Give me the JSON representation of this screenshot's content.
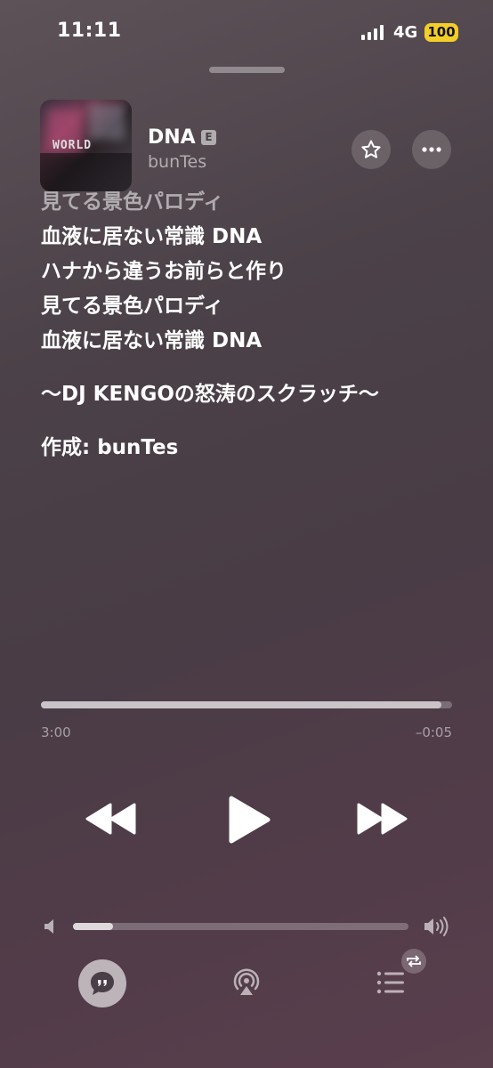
{
  "status": {
    "time": "11:11",
    "network": "4G",
    "battery": "100"
  },
  "track": {
    "title": "DNA",
    "explicit_badge": "E",
    "artist": "bunTes",
    "artwork_text": "WORLD"
  },
  "lyrics": {
    "lines": [
      "見てる景色パロディ",
      "血液に居ない常識 DNA",
      "ハナから違うお前らと作り",
      "見てる景色パロディ",
      "血液に居ない常識 DNA",
      "",
      "〜DJ KENGOの怒涛のスクラッチ〜",
      "",
      "作成: bunTes"
    ]
  },
  "playback": {
    "elapsed": "3:00",
    "remaining": "–0:05",
    "progress_fraction": 0.973,
    "volume_fraction": 0.12
  },
  "icons": {
    "favorite": "star-icon",
    "more": "ellipsis-icon",
    "rewind": "rewind-icon",
    "play": "play-icon",
    "forward": "fast-forward-icon",
    "lyrics": "quote-bubble-icon",
    "airplay": "airplay-icon",
    "queue": "list-icon",
    "repeat": "repeat-icon"
  }
}
